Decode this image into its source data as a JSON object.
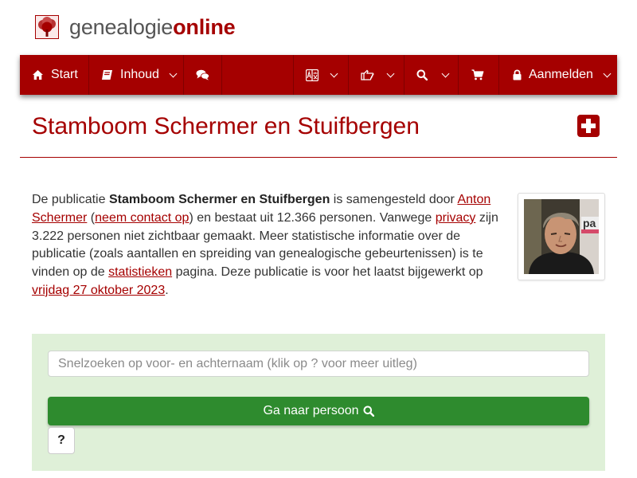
{
  "brand": {
    "part1": "genealogie",
    "part2": "online",
    "logo_icon": "tree-icon"
  },
  "colors": {
    "primary": "#a50000",
    "nav_separator": "#7f0000",
    "panel_bg": "#dff0d8",
    "go_button": "#2e8b2e"
  },
  "nav": {
    "start_label": "Start",
    "inhoud_label": "Inhoud",
    "aanmelden_label": "Aanmelden",
    "icons": [
      "home-icon",
      "book-icon",
      "chat-icon",
      "translate-icon",
      "share-icon",
      "search-icon",
      "cart-icon",
      "lock-icon"
    ]
  },
  "page": {
    "title": "Stamboom Schermer en Stuifbergen",
    "action_icon": "plus-square-icon"
  },
  "description": {
    "t1": "De publicatie ",
    "pub_name": "Stamboom Schermer en Stuifbergen",
    "t2": " is samengesteld door ",
    "author_link": "Anton Schermer",
    "t3": " (",
    "contact_link": "neem contact op",
    "t4": ") en bestaat uit 12.366 personen. Vanwege ",
    "privacy_link": "privacy",
    "t5": " zijn 3.222 personen niet zichtbaar gemaakt. Meer statistische informatie over de publicatie (zoals aantallen en spreiding van genealogische gebeurtenissen) is te vinden op de ",
    "stats_link": "statistieken",
    "t6": " pagina. Deze publicatie is voor het laatst bijgewerkt op ",
    "date_link": "vrijdag 27 oktober 2023",
    "t7": "."
  },
  "search": {
    "placeholder": "Snelzoeken op voor- en achternaam (klik op ? voor meer uitleg)",
    "value": "",
    "go_label": "Ga naar persoon",
    "help_label": "?"
  }
}
